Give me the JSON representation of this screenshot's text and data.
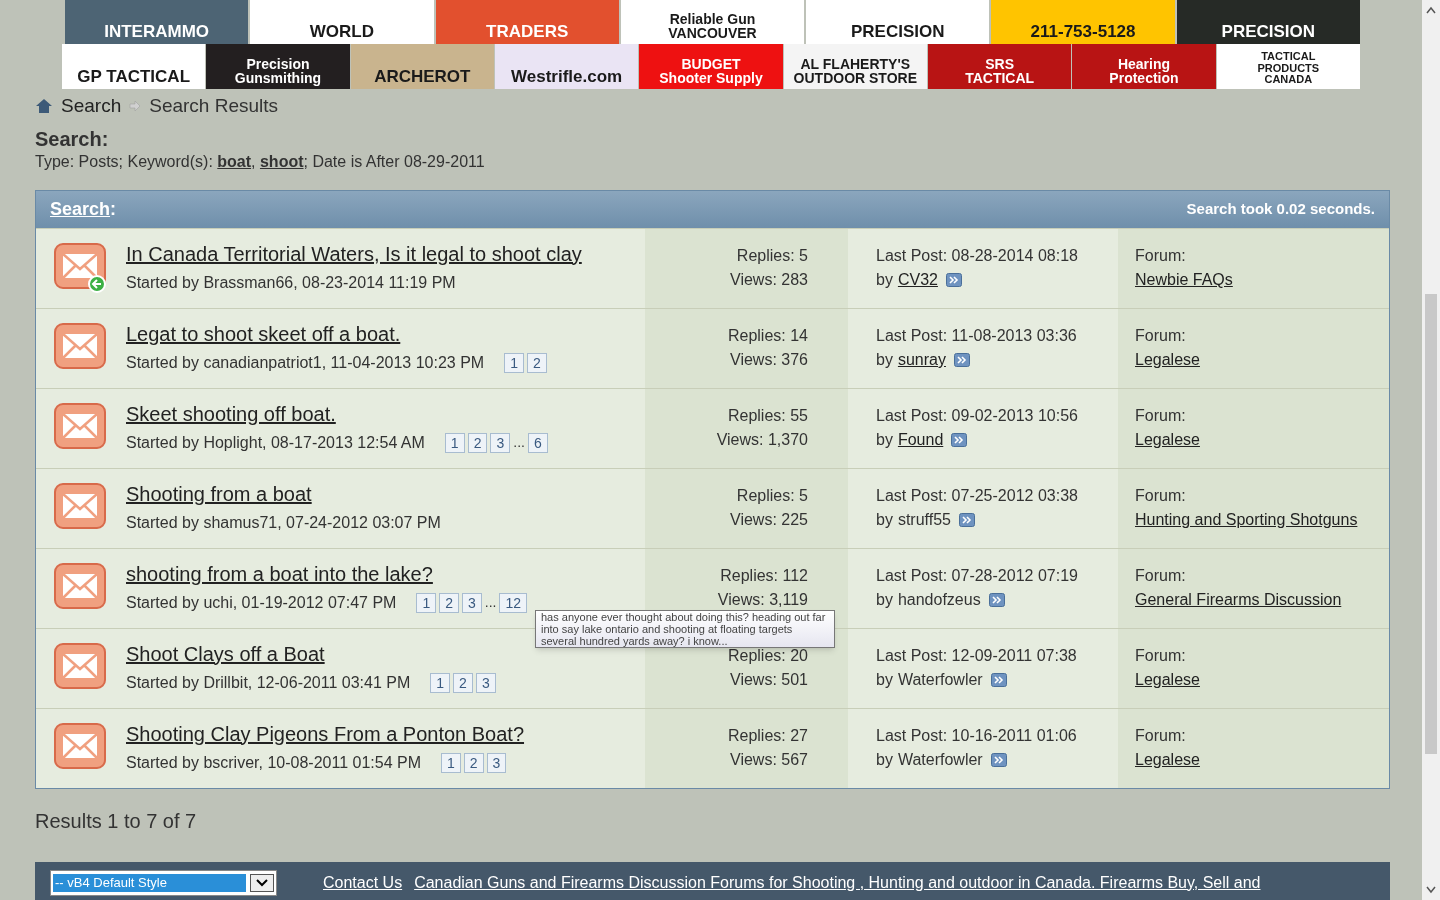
{
  "banners_top": [
    {
      "lines": [
        "INTERAMMO"
      ],
      "color": "#4d6474"
    },
    {
      "lines": [
        "WORLD"
      ],
      "color": "#ffffff"
    },
    {
      "lines": [
        "TRADERS"
      ],
      "color": "#e2502e"
    },
    {
      "lines": [
        "Reliable Gun",
        "VANCOUVER"
      ],
      "color": "#ffffff"
    },
    {
      "lines": [
        "PRECISION"
      ],
      "color": "#ffffff"
    },
    {
      "lines": [
        "211-753-5128"
      ],
      "color": "#ffc400"
    },
    {
      "lines": [
        "PRECISION"
      ],
      "color": "#262a26"
    }
  ],
  "banners_bottom": [
    {
      "lines": [
        "GP TACTICAL"
      ],
      "color": "#ffffff"
    },
    {
      "lines": [
        "Precision",
        "Gunsmithing"
      ],
      "color": "#231f20"
    },
    {
      "lines": [
        "ARCHEROT"
      ],
      "color": "#c9b48e"
    },
    {
      "lines": [
        "Westrifle.com"
      ],
      "color": "#eae4f4"
    },
    {
      "lines": [
        "BUDGET",
        "Shooter Supply"
      ],
      "color": "#ee1111"
    },
    {
      "lines": [
        "AL FLAHERTY'S",
        "OUTDOOR STORE"
      ],
      "color": "#f4f4f4"
    },
    {
      "lines": [
        "SRS",
        "TACTICAL"
      ],
      "color": "#b81414"
    },
    {
      "lines": [
        "Hearing",
        "Protection"
      ],
      "color": "#b81414"
    },
    {
      "lines": [
        "TACTICAL",
        "PRODUCTS",
        "CANADA"
      ],
      "color": "#ffffff"
    }
  ],
  "breadcrumb": [
    "Search",
    "Search Results"
  ],
  "search_heading": "Search:",
  "search_summary": "Type: Posts; Keyword(s): **boat**, **shoot**; Date is After 08-29-2011",
  "results_header": {
    "link": "Search",
    "suffix": ":",
    "timing": "Search took 0.02 seconds."
  },
  "rows": [
    {
      "title": "In Canada Territorial Waters, Is it legal to shoot clay",
      "started": "Started by Brassman66, 08-23-2014 11:19 PM",
      "unread": true,
      "pages": [],
      "replies": "Replies: 5",
      "views": "Views: 283",
      "last_post": "Last Post: 08-28-2014 08:18",
      "by": "by",
      "last_user": "CV32",
      "user_link": true,
      "forum_label": "Forum:",
      "forum": "Newbie FAQs"
    },
    {
      "title": "Legat to shoot skeet off a boat.",
      "started": "Started by canadianpatriot1, 11-04-2013 10:23 PM",
      "unread": false,
      "pages": [
        {
          "kind": "page",
          "label": "1"
        },
        {
          "kind": "page",
          "label": "2"
        }
      ],
      "replies": "Replies: 14",
      "views": "Views: 376",
      "last_post": "Last Post: 11-08-2013 03:36",
      "by": "by",
      "last_user": "sunray",
      "user_link": true,
      "forum_label": "Forum:",
      "forum": "Legalese"
    },
    {
      "title": "Skeet shooting off boat.",
      "started": "Started by Hoplight, 08-17-2013 12:54 AM",
      "unread": false,
      "pages": [
        {
          "kind": "page",
          "label": "1"
        },
        {
          "kind": "page",
          "label": "2"
        },
        {
          "kind": "page",
          "label": "3"
        },
        {
          "kind": "gap",
          "label": "..."
        },
        {
          "kind": "page",
          "label": "6"
        }
      ],
      "replies": "Replies: 55",
      "views": "Views: 1,370",
      "last_post": "Last Post: 09-02-2013 10:56",
      "by": "by",
      "last_user": "Found",
      "user_link": true,
      "forum_label": "Forum:",
      "forum": "Legalese"
    },
    {
      "title": "Shooting from a boat",
      "started": "Started by shamus71, 07-24-2012 03:07 PM",
      "unread": false,
      "pages": [],
      "replies": "Replies: 5",
      "views": "Views: 225",
      "last_post": "Last Post: 07-25-2012 03:38",
      "by": "by",
      "last_user": "struff55",
      "user_link": false,
      "forum_label": "Forum:",
      "forum": "Hunting and Sporting Shotguns"
    },
    {
      "title": "shooting from a boat into the lake?",
      "started": "Started by uchi, 01-19-2012 07:47 PM",
      "unread": false,
      "pages": [
        {
          "kind": "page",
          "label": "1"
        },
        {
          "kind": "page",
          "label": "2"
        },
        {
          "kind": "page",
          "label": "3"
        },
        {
          "kind": "gap",
          "label": "..."
        },
        {
          "kind": "page",
          "label": "12"
        }
      ],
      "replies": "Replies: 112",
      "views": "Views: 3,119",
      "last_post": "Last Post: 07-28-2012 07:19",
      "by": "by",
      "last_user": "handofzeus",
      "user_link": false,
      "forum_label": "Forum:",
      "forum": "General Firearms Discussion"
    },
    {
      "title": "Shoot Clays off a Boat",
      "started": "Started by Drillbit, 12-06-2011 03:41 PM",
      "unread": false,
      "pages": [
        {
          "kind": "page",
          "label": "1"
        },
        {
          "kind": "page",
          "label": "2"
        },
        {
          "kind": "page",
          "label": "3"
        }
      ],
      "replies": "Replies: 20",
      "views": "Views: 501",
      "last_post": "Last Post: 12-09-2011 07:38",
      "by": "by",
      "last_user": "Waterfowler",
      "user_link": false,
      "forum_label": "Forum:",
      "forum": "Legalese"
    },
    {
      "title": "Shooting Clay Pigeons From a Ponton Boat?",
      "started": "Started by bscriver, 10-08-2011 01:54 PM",
      "unread": false,
      "pages": [
        {
          "kind": "page",
          "label": "1"
        },
        {
          "kind": "page",
          "label": "2"
        },
        {
          "kind": "page",
          "label": "3"
        }
      ],
      "replies": "Replies: 27",
      "views": "Views: 567",
      "last_post": "Last Post: 10-16-2011 01:06",
      "by": "by",
      "last_user": "Waterfowler",
      "user_link": false,
      "forum_label": "Forum:",
      "forum": "Legalese"
    }
  ],
  "tooltip": "has anyone ever thought about doing this?  heading out far into say lake ontario and shooting at floating targets several hundred yards away?  i know...",
  "results_count": "Results 1 to 7 of 7",
  "footer": {
    "style_select": "-- vB4 Default Style",
    "links": [
      "Contact Us",
      "Canadian Guns and Firearms Discussion Forums for Shooting , Hunting and outdoor in Canada. Firearms Buy, Sell and"
    ]
  }
}
